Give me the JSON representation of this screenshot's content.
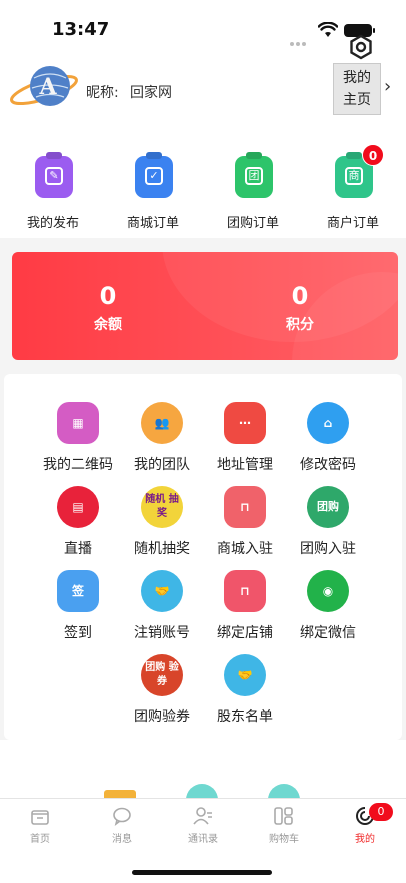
{
  "status_bar": {
    "time": "13:47"
  },
  "profile": {
    "nickname_label": "昵称:",
    "nickname_value": "回家网",
    "home_button_line1": "我的",
    "home_button_line2": "主页",
    "avatar_text": "A"
  },
  "orders": [
    {
      "label": "我的发布",
      "icon": "edit-icon",
      "color": "#9b5cf0",
      "glyph": "✎"
    },
    {
      "label": "商城订单",
      "icon": "clipboard-check-icon",
      "color": "#3b82f0",
      "glyph": "✓"
    },
    {
      "label": "团购订单",
      "icon": "group-order-icon",
      "color": "#2dc46a",
      "glyph": "团"
    },
    {
      "label": "商户订单",
      "icon": "merchant-order-icon",
      "color": "#2fc58a",
      "glyph": "商",
      "badge": "0"
    }
  ],
  "balance": {
    "balance_value": "0",
    "balance_label": "余额",
    "points_value": "0",
    "points_label": "积分"
  },
  "menu": [
    {
      "label": "我的二维码",
      "icon": "qrcode-icon",
      "color": "#d45cc4",
      "glyph": "▦"
    },
    {
      "label": "我的团队",
      "icon": "team-icon",
      "color": "#f6a640",
      "glyph": "👥"
    },
    {
      "label": "地址管理",
      "icon": "share-icon",
      "color": "#ef4a42",
      "glyph": "⋯"
    },
    {
      "label": "修改密码",
      "icon": "home-lock-icon",
      "color": "#2f9ff0",
      "glyph": "⌂"
    },
    {
      "label": "直播",
      "icon": "clapper-icon",
      "color": "#e8223a",
      "glyph": "▤"
    },
    {
      "label": "随机抽奖",
      "icon": "lottery-icon",
      "color": "#f2d43a",
      "glyph": "随机 抽奖"
    },
    {
      "label": "商城入驻",
      "icon": "shopping-bag-icon",
      "color": "#f0626a",
      "glyph": "⊓"
    },
    {
      "label": "团购入驻",
      "icon": "group-buy-sticker-icon",
      "color": "#2ea86a",
      "glyph": "团购"
    },
    {
      "label": "签到",
      "icon": "calendar-sign-icon",
      "color": "#4aa0f0",
      "glyph": "签"
    },
    {
      "label": "注销账号",
      "icon": "handshake-icon",
      "color": "#3fb6e6",
      "glyph": "🤝"
    },
    {
      "label": "绑定店铺",
      "icon": "store-bag-icon",
      "color": "#f0556a",
      "glyph": "⊓"
    },
    {
      "label": "绑定微信",
      "icon": "wechat-icon",
      "color": "#22b24a",
      "glyph": "◉"
    },
    {
      "label": "团购验券",
      "icon": "verify-coupon-icon",
      "color": "#d8452a",
      "glyph": "团购 验券"
    },
    {
      "label": "股东名单",
      "icon": "shareholder-icon",
      "color": "#3fb6e6",
      "glyph": "🤝"
    }
  ],
  "tabs": [
    {
      "label": "首页",
      "icon": "home-store-icon"
    },
    {
      "label": "消息",
      "icon": "chat-bubble-icon"
    },
    {
      "label": "通讯录",
      "icon": "contacts-icon"
    },
    {
      "label": "购物车",
      "icon": "cart-grid-icon"
    },
    {
      "label": "我的",
      "icon": "profile-swirl-icon",
      "badge": "0",
      "active": true
    }
  ]
}
